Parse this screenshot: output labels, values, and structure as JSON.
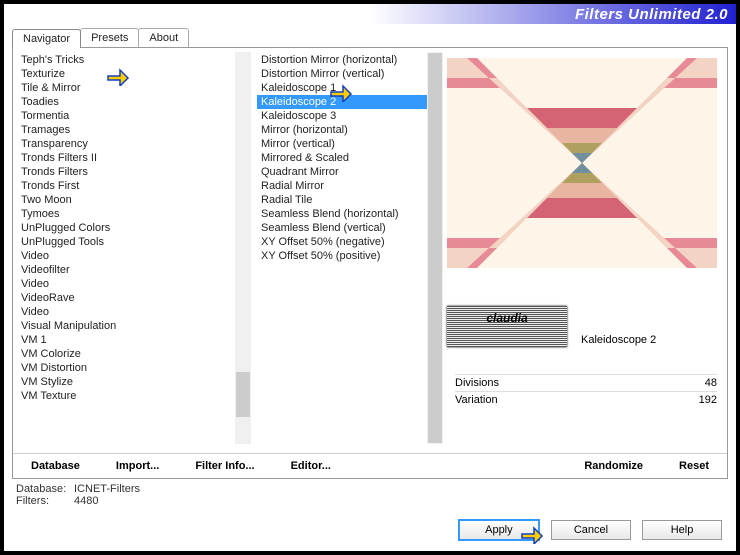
{
  "title": "Filters Unlimited 2.0",
  "tabs": [
    "Navigator",
    "Presets",
    "About"
  ],
  "active_tab": 0,
  "categories": [
    "Teph's Tricks",
    "Texturize",
    "Tile & Mirror",
    "Toadies",
    "Tormentia",
    "Tramages",
    "Transparency",
    "Tronds Filters II",
    "Tronds Filters",
    "Tronds First",
    "Two Moon",
    "Tymoes",
    "UnPlugged Colors",
    "UnPlugged Tools",
    "Video",
    "Videofilter",
    "Video",
    "VideoRave",
    "Video",
    "Visual Manipulation",
    "VM 1",
    "VM Colorize",
    "VM Distortion",
    "VM Stylize",
    "VM Texture"
  ],
  "categories_selected_index": 2,
  "filters": [
    "Distortion Mirror (horizontal)",
    "Distortion Mirror (vertical)",
    "Kaleidoscope 1",
    "Kaleidoscope 2",
    "Kaleidoscope 3",
    "Mirror (horizontal)",
    "Mirror (vertical)",
    "Mirrored & Scaled",
    "Quadrant Mirror",
    "Radial Mirror",
    "Radial Tile",
    "Seamless Blend (horizontal)",
    "Seamless Blend (vertical)",
    "XY Offset 50% (negative)",
    "XY Offset 50% (positive)"
  ],
  "filters_selected_index": 3,
  "current_filter": "Kaleidoscope 2",
  "params": [
    {
      "label": "Divisions",
      "value": "48"
    },
    {
      "label": "Variation",
      "value": "192"
    }
  ],
  "bottom_links": [
    "Database",
    "Import...",
    "Filter Info...",
    "Editor...",
    "Randomize",
    "Reset"
  ],
  "db_label": "Database:",
  "db_name": "ICNET-Filters",
  "filters_label": "Filters:",
  "filters_count": "4480",
  "buttons": {
    "apply": "Apply",
    "cancel": "Cancel",
    "help": "Help"
  },
  "badge": "claudia"
}
